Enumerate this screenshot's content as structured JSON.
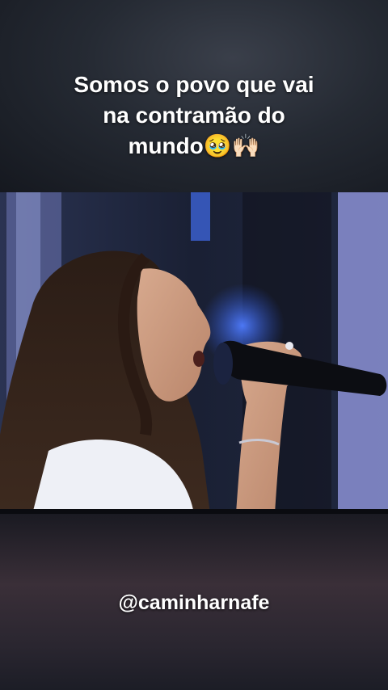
{
  "caption": {
    "line1": "Somos o povo que vai",
    "line2": "na contramão do",
    "line3": "mundo🥹🙌🏻"
  },
  "handle": "@caminharnafe",
  "video": {
    "scene": "singer-with-microphone"
  }
}
